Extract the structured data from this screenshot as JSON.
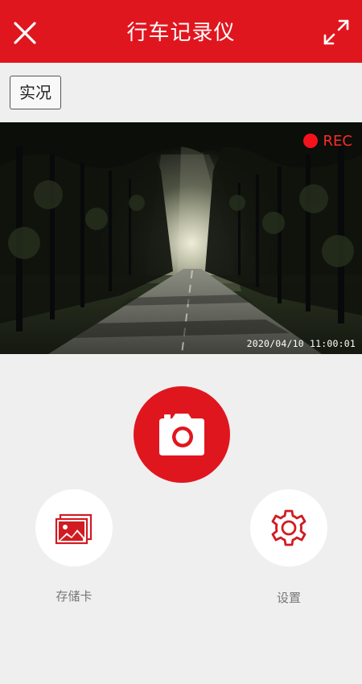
{
  "header": {
    "title": "行车记录仪",
    "close_icon": "close-icon",
    "expand_icon": "expand-arrows-icon"
  },
  "tabs": {
    "live_label": "实况"
  },
  "video": {
    "rec_label": "REC",
    "timestamp": "2020/04/10 11:00:01"
  },
  "controls": {
    "shutter_icon": "camera-icon",
    "storage": {
      "label": "存储卡",
      "icon": "gallery-icon"
    },
    "settings": {
      "label": "设置",
      "icon": "gear-icon"
    }
  },
  "colors": {
    "accent": "#e0161f",
    "rec": "#f4121d",
    "background": "#efefef"
  }
}
